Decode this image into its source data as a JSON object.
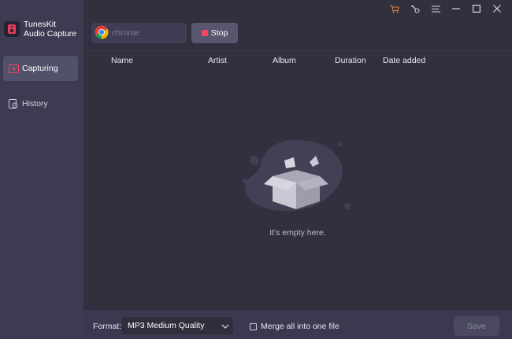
{
  "app": {
    "name_line1": "TunesKit",
    "name_line2": "Audio Capture"
  },
  "sidebar": {
    "items": [
      {
        "label": "Capturing",
        "icon": "capturing-icon",
        "active": true
      },
      {
        "label": "History",
        "icon": "history-icon",
        "active": false
      }
    ]
  },
  "window_controls": [
    "cart-icon",
    "key-icon",
    "menu-icon",
    "minimize-icon",
    "maximize-icon",
    "close-icon"
  ],
  "colors": {
    "cart": "#e8823a",
    "stop": "#f2465f",
    "sidebar_bg": "#3c3b52",
    "main_bg": "#31303f"
  },
  "toolbar": {
    "source_placeholder": "chrome",
    "source_icon": "chrome-icon",
    "stop_label": "Stop"
  },
  "table": {
    "columns": [
      "Name",
      "Artist",
      "Album",
      "Duration",
      "Date added"
    ]
  },
  "empty_state": {
    "text": "It's empty here."
  },
  "footer": {
    "format_label": "Format:",
    "format_value": "MP3 Medium Quality",
    "merge_label": "Merge all into one file",
    "merge_checked": false,
    "save_label": "Save"
  }
}
